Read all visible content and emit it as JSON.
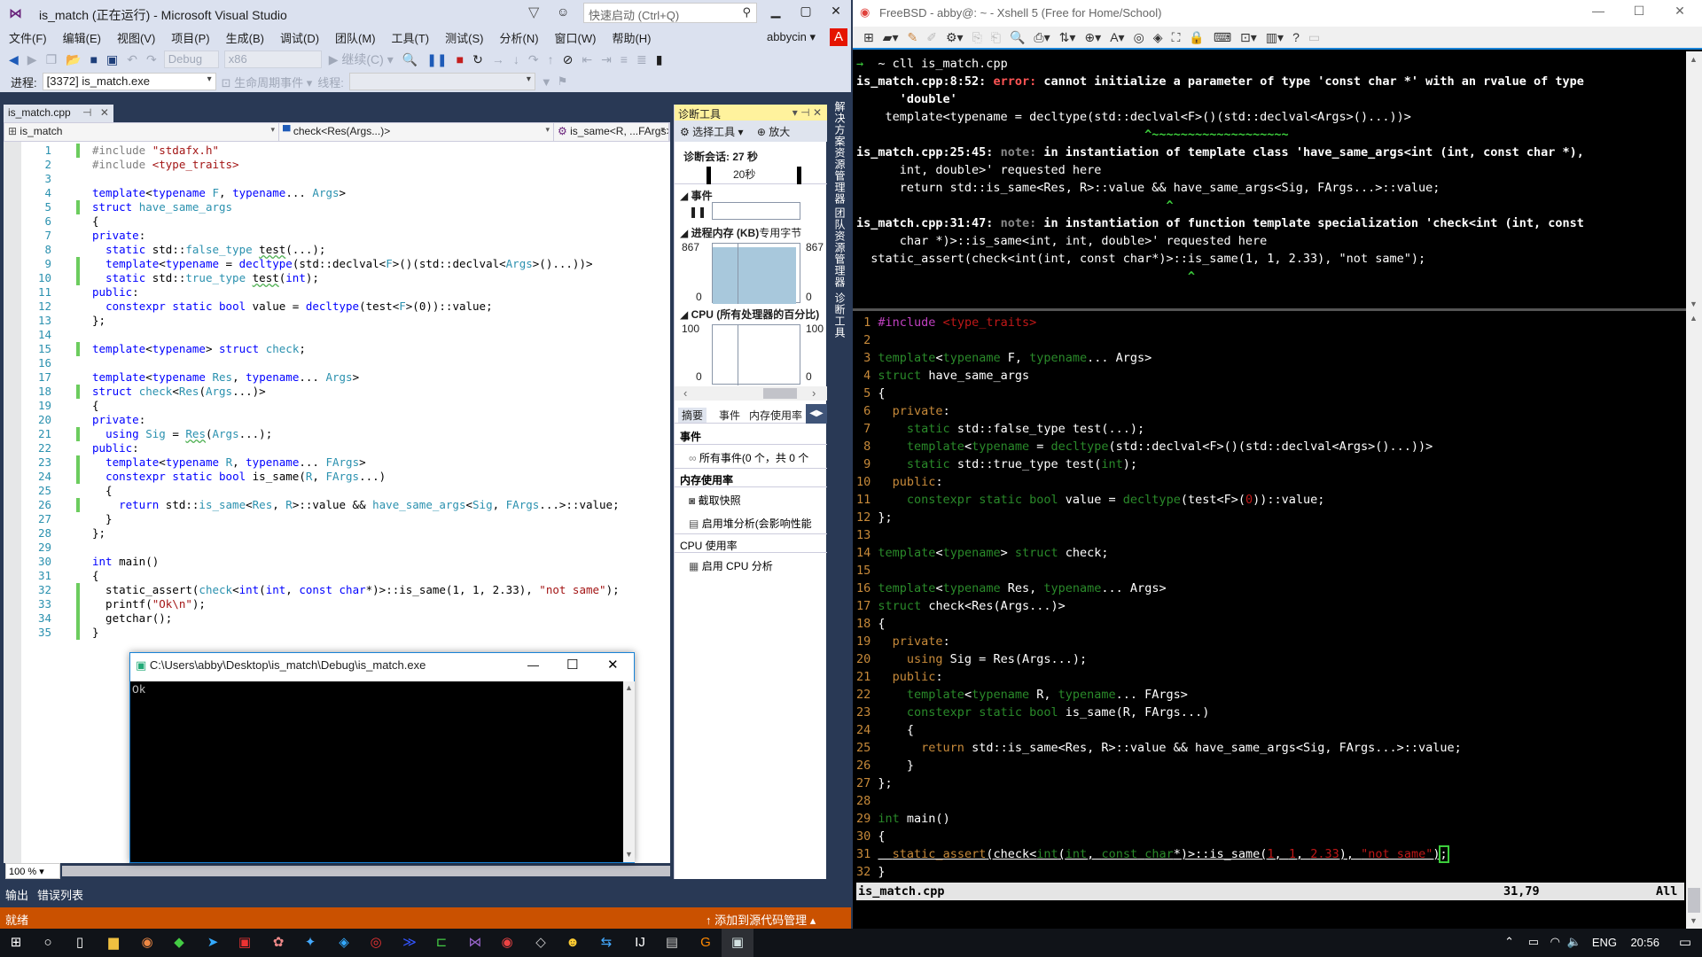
{
  "vs": {
    "title": "is_match (正在运行) - Microsoft Visual Studio",
    "quick_launch_placeholder": "快速启动 (Ctrl+Q)",
    "menu": [
      "文件(F)",
      "编辑(E)",
      "视图(V)",
      "项目(P)",
      "生成(B)",
      "调试(D)",
      "团队(M)",
      "工具(T)",
      "测试(S)",
      "分析(N)",
      "窗口(W)",
      "帮助(H)"
    ],
    "user": "abbycin",
    "account_initial": "A",
    "toolbar": {
      "config": "Debug",
      "platform": "x86",
      "continue": "继续(C)"
    },
    "toolbar2": {
      "process_label": "进程:",
      "process_value": "[3372] is_match.exe",
      "lifecycle": "生命周期事件",
      "thread_label": "线程:"
    },
    "tab": {
      "name": "is_match.cpp",
      "pin": "⊣",
      "close": "✕"
    },
    "nav": {
      "project": "is_match",
      "scope": "check<Res(Args...)>",
      "member": "is_same<R, ...FArgs>"
    },
    "zoom": "100 %",
    "bottom_tabs": [
      "输出",
      "错误列表"
    ],
    "status": {
      "left": "就绪",
      "right": "添加到源代码管理"
    },
    "code_lines": [
      "1",
      "2",
      "3",
      "4",
      "5",
      "6",
      "7",
      "8",
      "9",
      "10",
      "11",
      "12",
      "13",
      "14",
      "15",
      "16",
      "17",
      "18",
      "19",
      "20",
      "21",
      "22",
      "23",
      "24",
      "25",
      "26",
      "27",
      "28",
      "29",
      "30",
      "31",
      "32",
      "33",
      "34",
      "35"
    ]
  },
  "diag": {
    "title": "诊断工具",
    "select_tool": "选择工具",
    "zoom": "放大",
    "session": "诊断会话: 27 秒",
    "timeline": "20秒",
    "events_header": "事件",
    "memory_header": "进程内存 (KB)",
    "memory_legend": "专用字节",
    "memory_max": "867",
    "memory_min": "0",
    "cpu_header": "CPU (所有处理器的百分比)",
    "cpu_max": "100",
    "cpu_min": "0",
    "tabs": [
      "摘要",
      "事件",
      "内存使用率"
    ],
    "sections": [
      {
        "title": "事件",
        "items": [
          "所有事件(0 个，共 0 个"
        ]
      },
      {
        "title": "内存使用率",
        "items": [
          "截取快照",
          "启用堆分析(会影响性能"
        ]
      },
      {
        "title": "CPU 使用率",
        "items": [
          "启用 CPU 分析"
        ]
      }
    ]
  },
  "side_tabs": [
    "解决方案资源管理器",
    "团队资源管理器",
    "诊断工具"
  ],
  "console": {
    "title": "C:\\Users\\abby\\Desktop\\is_match\\Debug\\is_match.exe",
    "output": "Ok"
  },
  "xshell": {
    "title": "FreeBSD - abby@: ~ - Xshell 5 (Free for Home/School)",
    "prompt": "→  ~ cll is_match.cpp",
    "diagnostics": [
      {
        "loc": "is_match.cpp:8:52:",
        "kind": "error:",
        "msg": " cannot initialize a parameter of type 'const char *' with an rvalue of type",
        "cont": "      'double'",
        "src": "    template<typename = decltype(std::declval<F>()(std::declval<Args>()...))>",
        "caret": "                                        ^~~~~~~~~~~~~~~~~~~~"
      },
      {
        "loc": "is_match.cpp:25:45:",
        "kind": "note:",
        "msg": " in instantiation of template class 'have_same_args<int (int, const char *),",
        "cont": "      int, double>' requested here",
        "src": "      return std::is_same<Res, R>::value && have_same_args<Sig, FArgs...>::value;",
        "caret": "                                           ^"
      },
      {
        "loc": "is_match.cpp:31:47:",
        "kind": "note:",
        "msg": " in instantiation of function template specialization 'check<int (int, const",
        "cont": "      char *)>::is_same<int, int, double>' requested here",
        "src": "  static_assert(check<int(int, const char*)>::is_same(1, 1, 2.33), \"not same\");",
        "caret": "                                              ^"
      }
    ],
    "vim_status": {
      "file": "is_match.cpp",
      "pos": "31,79",
      "scroll": "All"
    }
  },
  "taskbar": {
    "lang": "ENG",
    "time": "20:56"
  }
}
